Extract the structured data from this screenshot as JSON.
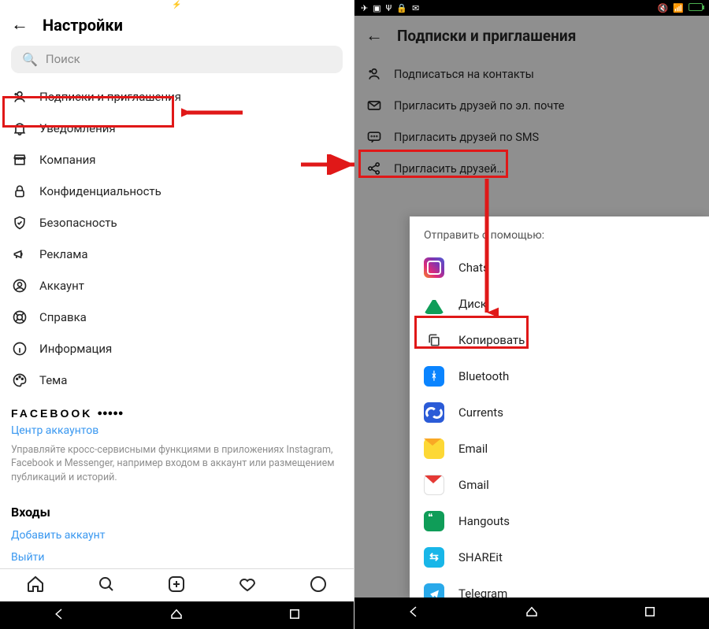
{
  "left": {
    "header_title": "Настройки",
    "search_placeholder": "Поиск",
    "settings": [
      {
        "label": "Подписки и приглашения",
        "icon": "user-plus-icon"
      },
      {
        "label": "Уведомления",
        "icon": "bell-icon"
      },
      {
        "label": "Компания",
        "icon": "storefront-icon"
      },
      {
        "label": "Конфиденциальность",
        "icon": "lock-icon"
      },
      {
        "label": "Безопасность",
        "icon": "shield-icon"
      },
      {
        "label": "Реклама",
        "icon": "megaphone-icon"
      },
      {
        "label": "Аккаунт",
        "icon": "user-icon"
      },
      {
        "label": "Справка",
        "icon": "lifebuoy-icon"
      },
      {
        "label": "Информация",
        "icon": "info-icon"
      },
      {
        "label": "Тема",
        "icon": "palette-icon"
      }
    ],
    "facebook_brand": "FACEBOOK",
    "facebook_glyphs": "●●●●●",
    "accounts_center_link": "Центр аккаунтов",
    "accounts_center_desc": "Управляйте кросс-сервисными функциями в приложениях Instagram, Facebook и Messenger, например входом в аккаунт или размещением публикаций и историй.",
    "logins_heading": "Входы",
    "add_account_link": "Добавить аккаунт",
    "logout_link": "Выйти"
  },
  "right": {
    "header_title": "Подписки и приглашения",
    "items": [
      {
        "label": "Подписаться на контакты",
        "icon": "user-plus-icon"
      },
      {
        "label": "Пригласить друзей по эл. почте",
        "icon": "envelope-icon"
      },
      {
        "label": "Пригласить друзей по SMS",
        "icon": "sms-icon"
      },
      {
        "label": "Пригласить друзей…",
        "icon": "share-icon"
      }
    ],
    "share_sheet_title": "Отправить с помощью:",
    "share_targets": [
      {
        "label": "Chats",
        "icon_class": "ic-ig",
        "name": "share-chats"
      },
      {
        "label": "Диск",
        "icon_class": "ic-drive",
        "name": "share-drive"
      },
      {
        "label": "Копировать",
        "icon_class": "ic-copy",
        "name": "share-copy"
      },
      {
        "label": "Bluetooth",
        "icon_class": "ic-bt",
        "name": "share-bluetooth"
      },
      {
        "label": "Currents",
        "icon_class": "ic-currents",
        "name": "share-currents"
      },
      {
        "label": "Email",
        "icon_class": "ic-email",
        "name": "share-email"
      },
      {
        "label": "Gmail",
        "icon_class": "ic-gmail",
        "name": "share-gmail"
      },
      {
        "label": "Hangouts",
        "icon_class": "ic-hangouts",
        "name": "share-hangouts"
      },
      {
        "label": "SHAREit",
        "icon_class": "ic-shareit",
        "name": "share-shareit"
      },
      {
        "label": "Telegram",
        "icon_class": "ic-tg",
        "name": "share-telegram"
      }
    ]
  },
  "annotations": {
    "highlight_color": "#e01818"
  }
}
